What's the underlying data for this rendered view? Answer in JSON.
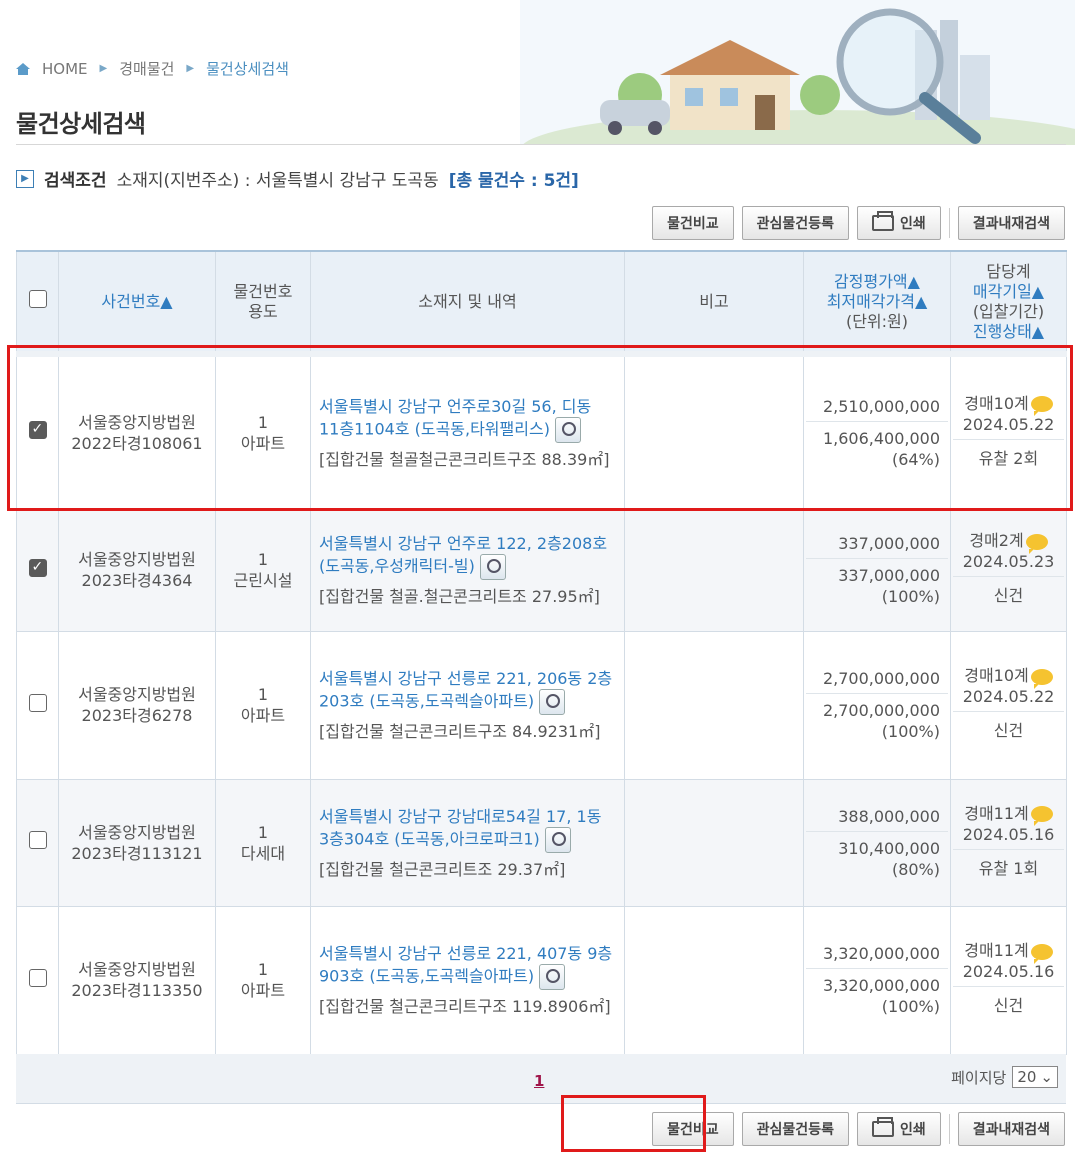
{
  "breadcrumb": {
    "home": "HOME",
    "level1": "경매물건",
    "level2": "물건상세검색"
  },
  "page_title": "물건상세검색",
  "search_condition": {
    "label": "검색조건",
    "text": "소재지(지번주소) : 서울특별시 강남구 도곡동",
    "total": "[총 물건수 : 5건]"
  },
  "buttons": {
    "compare": "물건비교",
    "interest": "관심물건등록",
    "print": "인쇄",
    "research": "결과내재검색"
  },
  "table": {
    "headers": {
      "case_no": "사건번호▲",
      "item_no": "물건번호",
      "usage": "용도",
      "address": "소재지 및 내역",
      "note": "비고",
      "appraisal": "감정평가액▲",
      "min_price": "최저매각가격▲",
      "unit": "(단위:원)",
      "dept": "담당계",
      "sale_date": "매각기일▲",
      "bid_period": "(입찰기간)",
      "status": "진행상태▲"
    },
    "rows": [
      {
        "checked": true,
        "court": "서울중앙지방법원",
        "case": "2022타경108061",
        "item": "1",
        "usage": "아파트",
        "address": "서울특별시 강남구 언주로30길 56, 디동 11층1104호 (도곡동,타워팰리스)",
        "detail": "[집합건물 철골철근콘크리트구조 88.39㎡]",
        "appraisal": "2,510,000,000",
        "min_price": "1,606,400,000",
        "pct": "(64%)",
        "dept": "경매10계",
        "date": "2024.05.22",
        "status": "유찰 2회"
      },
      {
        "checked": true,
        "court": "서울중앙지방법원",
        "case": "2023타경4364",
        "item": "1",
        "usage": "근린시설",
        "address": "서울특별시 강남구 언주로 122, 2층208호 (도곡동,우성캐릭터-빌)",
        "detail": "[집합건물 철골.철근콘크리트조 27.95㎡]",
        "appraisal": "337,000,000",
        "min_price": "337,000,000",
        "pct": "(100%)",
        "dept": "경매2계",
        "date": "2024.05.23",
        "status": "신건"
      },
      {
        "checked": false,
        "court": "서울중앙지방법원",
        "case": "2023타경6278",
        "item": "1",
        "usage": "아파트",
        "address": "서울특별시 강남구 선릉로 221, 206동 2층203호 (도곡동,도곡렉슬아파트)",
        "detail": "[집합건물 철근콘크리트구조 84.9231㎡]",
        "appraisal": "2,700,000,000",
        "min_price": "2,700,000,000",
        "pct": "(100%)",
        "dept": "경매10계",
        "date": "2024.05.22",
        "status": "신건"
      },
      {
        "checked": false,
        "court": "서울중앙지방법원",
        "case": "2023타경113121",
        "item": "1",
        "usage": "다세대",
        "address": "서울특별시 강남구 강남대로54길 17, 1동 3층304호 (도곡동,아크로파크1)",
        "detail": "[집합건물 철근콘크리트조 29.37㎡]",
        "appraisal": "388,000,000",
        "min_price": "310,400,000",
        "pct": "(80%)",
        "dept": "경매11계",
        "date": "2024.05.16",
        "status": "유찰 1회"
      },
      {
        "checked": false,
        "court": "서울중앙지방법원",
        "case": "2023타경113350",
        "item": "1",
        "usage": "아파트",
        "address": "서울특별시 강남구 선릉로 221, 407동 9층903호 (도곡동,도곡렉슬아파트)",
        "detail": "[집합건물 철근콘크리트구조 119.8906㎡]",
        "appraisal": "3,320,000,000",
        "min_price": "3,320,000,000",
        "pct": "(100%)",
        "dept": "경매11계",
        "date": "2024.05.16",
        "status": "신건"
      }
    ]
  },
  "pager": {
    "page": "1",
    "per_page_label": "페이지당",
    "per_page_value": "20"
  },
  "colors": {
    "accent": "#2f7cc0",
    "highlight": "#e01a1a",
    "page_link": "#a0154a"
  }
}
